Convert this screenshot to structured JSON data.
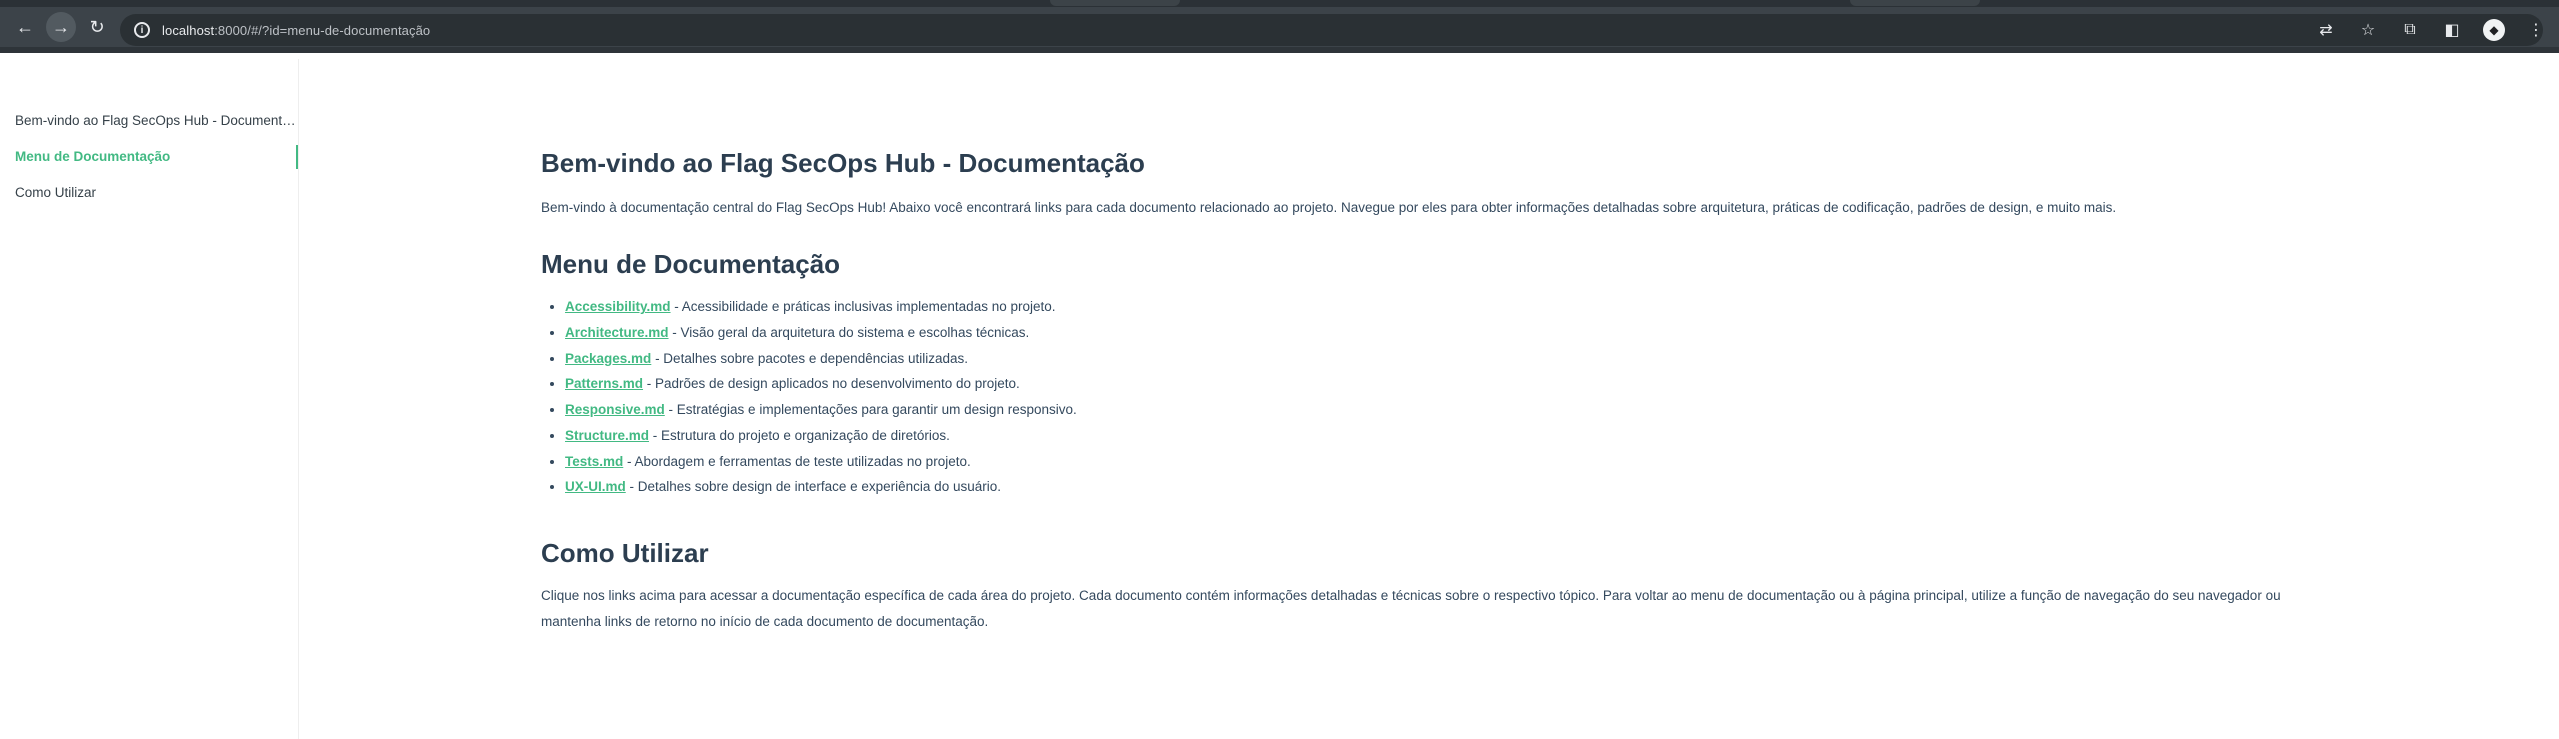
{
  "browser": {
    "url_host": "localhost",
    "url_rest": ":8000/#/?id=menu-de-documentação",
    "nav": {
      "back": "←",
      "forward": "→",
      "reload": "↻"
    },
    "icons": [
      "translate-icon",
      "star-icon",
      "extensions-icon",
      "sidebar-icon",
      "profile-icon",
      "menu-icon"
    ]
  },
  "sidebar": {
    "items": [
      {
        "label": "Bem-vindo ao Flag SecOps Hub - Documentação"
      },
      {
        "label": "Menu de Documentação"
      },
      {
        "label": "Como Utilizar"
      }
    ]
  },
  "content": {
    "h1": "Bem-vindo ao Flag SecOps Hub - Documentação",
    "intro": "Bem-vindo à documentação central do Flag SecOps Hub! Abaixo você encontrará links para cada documento relacionado ao projeto. Navegue por eles para obter informações detalhadas sobre arquitetura, práticas de codificação, padrões de design, e muito mais.",
    "menu_heading": "Menu de Documentação",
    "docs": [
      {
        "link": "Accessibility.md",
        "desc": " - Acessibilidade e práticas inclusivas implementadas no projeto."
      },
      {
        "link": "Architecture.md",
        "desc": " - Visão geral da arquitetura do sistema e escolhas técnicas."
      },
      {
        "link": "Packages.md",
        "desc": " - Detalhes sobre pacotes e dependências utilizadas."
      },
      {
        "link": "Patterns.md",
        "desc": " - Padrões de design aplicados no desenvolvimento do projeto."
      },
      {
        "link": "Responsive.md",
        "desc": " - Estratégias e implementações para garantir um design responsivo."
      },
      {
        "link": "Structure.md",
        "desc": " - Estrutura do projeto e organização de diretórios."
      },
      {
        "link": "Tests.md",
        "desc": " - Abordagem e ferramentas de teste utilizadas no projeto."
      },
      {
        "link": "UX-UI.md",
        "desc": " - Detalhes sobre design de interface e experiência do usuário."
      }
    ],
    "usage_heading": "Como Utilizar",
    "usage_text": "Clique nos links acima para acessar a documentação específica de cada área do projeto. Cada documento contém informações detalhadas e técnicas sobre o respectivo tópico. Para voltar ao menu de documentação ou à página principal, utilize a função de navegação do seu navegador ou mantenha links de retorno no início de cada documento de documentação."
  },
  "colors": {
    "accent": "#42b983",
    "text": "#34495e",
    "heading": "#2c3e50",
    "chrome": "#3c4349"
  }
}
